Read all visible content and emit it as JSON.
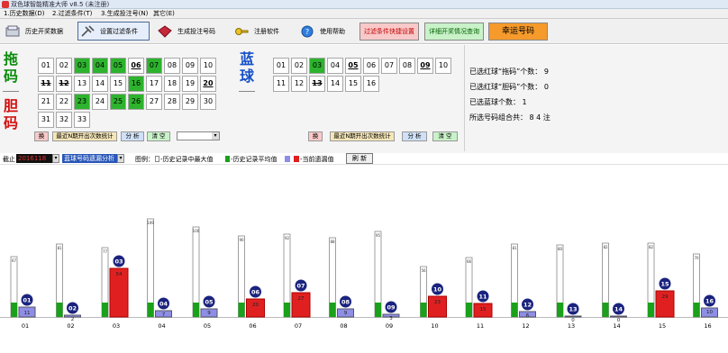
{
  "title": "双色球智能精准大师 v8.5  (未注册)",
  "menu": [
    "1.历史数据(D)",
    "2.过滤条件(T)",
    "3.生成投注号(N)",
    "其它(E)"
  ],
  "toolbar": [
    {
      "label": "历史开奖数据",
      "icon": "history-icon",
      "x": 8,
      "w": 70
    },
    {
      "label": "设置过滤条件",
      "icon": "filter-icon",
      "x": 86,
      "w": 78
    },
    {
      "label": "生成投注号码",
      "icon": "ruby-icon",
      "x": 175,
      "w": 72
    },
    {
      "label": "注册软件",
      "icon": "key-icon",
      "x": 260,
      "w": 60
    },
    {
      "label": "使用帮助",
      "icon": "help-icon",
      "x": 333,
      "w": 55
    }
  ],
  "color_buttons": [
    {
      "label": "过滤条件快捷设置",
      "bg": "#f9c9c9",
      "color": "#c00000"
    },
    {
      "label": "详细开奖情况查询",
      "bg": "#c9f2c9",
      "color": "#006000"
    },
    {
      "label": "幸运号码",
      "bg": "#f59a2b",
      "color": "#000000"
    }
  ],
  "red_labels": {
    "tuo": "拖码",
    "dan": "胆码"
  },
  "blue_label": "蓝球",
  "red_balls": [
    {
      "n": "01",
      "s": ""
    },
    {
      "n": "02",
      "s": ""
    },
    {
      "n": "03",
      "s": "g"
    },
    {
      "n": "04",
      "s": "g"
    },
    {
      "n": "05",
      "s": "g"
    },
    {
      "n": "06",
      "s": "b"
    },
    {
      "n": "07",
      "s": "g"
    },
    {
      "n": "08",
      "s": ""
    },
    {
      "n": "09",
      "s": ""
    },
    {
      "n": "10",
      "s": ""
    },
    {
      "n": "11",
      "s": "s"
    },
    {
      "n": "12",
      "s": "s"
    },
    {
      "n": "13",
      "s": ""
    },
    {
      "n": "14",
      "s": ""
    },
    {
      "n": "15",
      "s": ""
    },
    {
      "n": "16",
      "s": "g"
    },
    {
      "n": "17",
      "s": ""
    },
    {
      "n": "18",
      "s": ""
    },
    {
      "n": "19",
      "s": ""
    },
    {
      "n": "20",
      "s": "b"
    },
    {
      "n": "21",
      "s": ""
    },
    {
      "n": "22",
      "s": ""
    },
    {
      "n": "23",
      "s": "g"
    },
    {
      "n": "24",
      "s": ""
    },
    {
      "n": "25",
      "s": "g"
    },
    {
      "n": "26",
      "s": "g"
    },
    {
      "n": "27",
      "s": ""
    },
    {
      "n": "28",
      "s": ""
    },
    {
      "n": "29",
      "s": ""
    },
    {
      "n": "30",
      "s": ""
    },
    {
      "n": "31",
      "s": ""
    },
    {
      "n": "32",
      "s": ""
    },
    {
      "n": "33",
      "s": ""
    }
  ],
  "blue_balls": [
    {
      "n": "01",
      "s": ""
    },
    {
      "n": "02",
      "s": ""
    },
    {
      "n": "03",
      "s": "g"
    },
    {
      "n": "04",
      "s": ""
    },
    {
      "n": "05",
      "s": "b"
    },
    {
      "n": "06",
      "s": ""
    },
    {
      "n": "07",
      "s": ""
    },
    {
      "n": "08",
      "s": ""
    },
    {
      "n": "09",
      "s": "b"
    },
    {
      "n": "10",
      "s": ""
    },
    {
      "n": "11",
      "s": ""
    },
    {
      "n": "12",
      "s": ""
    },
    {
      "n": "13",
      "s": "s"
    },
    {
      "n": "14",
      "s": ""
    },
    {
      "n": "15",
      "s": ""
    },
    {
      "n": "16",
      "s": ""
    }
  ],
  "red_small_buttons": [
    "换",
    "最近N期开出次数统计",
    "分 析",
    "清 空"
  ],
  "blue_small_buttons": [
    "换",
    "最近N期开出次数统计",
    "分 析",
    "清 空"
  ],
  "info": [
    "已选红球“拖码”个数：  9",
    "已选红球“胆码”个数：  0",
    "已选蓝球个数：  1",
    "所选号码组合共：  8 4  注"
  ],
  "filter": {
    "cutoff_label": "截止",
    "cutoff_value": "2016118",
    "analysis": "蓝球号码遗漏分析",
    "legend_title": "图例：",
    "legend": [
      "-历史记录中最大值",
      "-历史记录平均值",
      "",
      "-当前遗漏值"
    ],
    "refresh": "刷 新"
  },
  "chart_data": {
    "type": "bar",
    "title": "",
    "categories": [
      "01",
      "02",
      "03",
      "04",
      "05",
      "06",
      "07",
      "08",
      "09",
      "10",
      "11",
      "12",
      "13",
      "14",
      "15",
      "16"
    ],
    "series": [
      {
        "name": "历史记录中最大值",
        "values": [
          67,
          81,
          77,
          109,
          100,
          90,
          92,
          88,
          95,
          56,
          66,
          81,
          80,
          82,
          82,
          70
        ],
        "color": "#ffffff"
      },
      {
        "name": "历史记录平均值",
        "values": [
          16,
          16,
          16,
          16,
          16,
          16,
          16,
          16,
          16,
          16,
          16,
          16,
          16,
          16,
          16,
          16
        ],
        "color": "#1aa01a"
      },
      {
        "name": "当前遗漏值",
        "values": [
          11,
          2,
          54,
          7,
          9,
          20,
          27,
          9,
          3,
          23,
          15,
          6,
          0,
          0,
          29,
          10
        ],
        "color": "#e02020"
      }
    ],
    "current_is_red": [
      false,
      false,
      true,
      false,
      false,
      true,
      true,
      false,
      false,
      true,
      true,
      false,
      false,
      false,
      true,
      false
    ],
    "ylim": [
      0,
      115
    ]
  }
}
